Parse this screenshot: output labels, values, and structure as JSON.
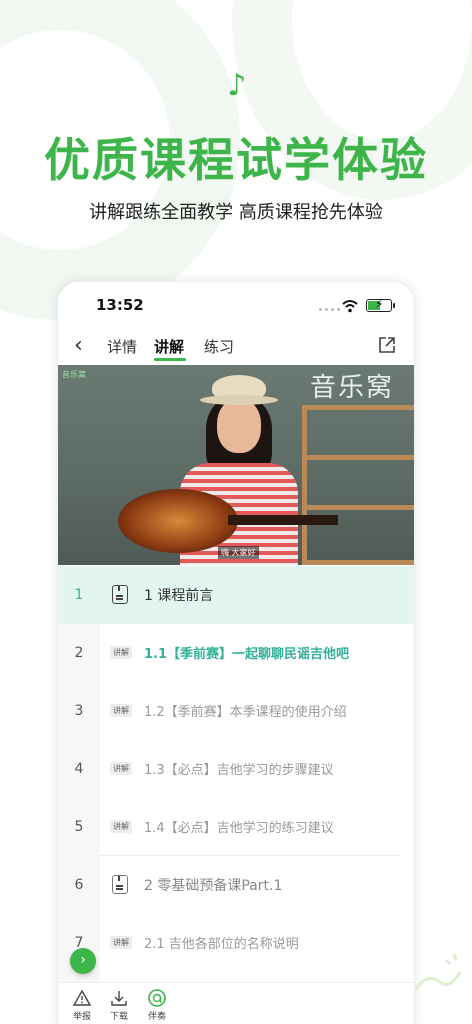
{
  "hero": {
    "title": "优质课程试学体验",
    "subtitle": "讲解跟练全面教学 高质课程抢先体验",
    "note_icon": "music-note-icon"
  },
  "colors": {
    "accent": "#3db54a",
    "teal": "#35b19a",
    "active_row_bg": "#e3f5ef"
  },
  "status_bar": {
    "time": "13:52"
  },
  "nav": {
    "tabs": [
      {
        "label": "详情"
      },
      {
        "label": "讲解",
        "active": true
      },
      {
        "label": "练习"
      }
    ]
  },
  "video": {
    "wall_text": "音乐窝",
    "logo_text": "音乐窝",
    "subtitle": "嗨 大家好"
  },
  "lessons": [
    {
      "num": "1",
      "type": "chapter",
      "title": "1 课程前言",
      "active": true
    },
    {
      "num": "2",
      "type": "lesson",
      "tag": "讲解",
      "title": "1.1【季前赛】一起聊聊民谣吉他吧",
      "current": true
    },
    {
      "num": "3",
      "type": "lesson",
      "tag": "讲解",
      "title": "1.2【季前赛】本季课程的使用介绍"
    },
    {
      "num": "4",
      "type": "lesson",
      "tag": "讲解",
      "title": "1.3【必点】吉他学习的步骤建议"
    },
    {
      "num": "5",
      "type": "lesson",
      "tag": "讲解",
      "title": "1.4【必点】吉他学习的练习建议"
    },
    {
      "num": "6",
      "type": "chapter",
      "title": "2 零基础预备课Part.1",
      "dim": true
    },
    {
      "num": "7",
      "type": "lesson",
      "tag": "讲解",
      "title": "2.1 吉他各部位的名称说明"
    }
  ],
  "bottom_bar": {
    "items": [
      {
        "label": "举报",
        "icon": "warning-icon"
      },
      {
        "label": "下载",
        "icon": "download-icon"
      },
      {
        "label": "伴奏",
        "icon": "accompaniment-icon"
      }
    ]
  }
}
